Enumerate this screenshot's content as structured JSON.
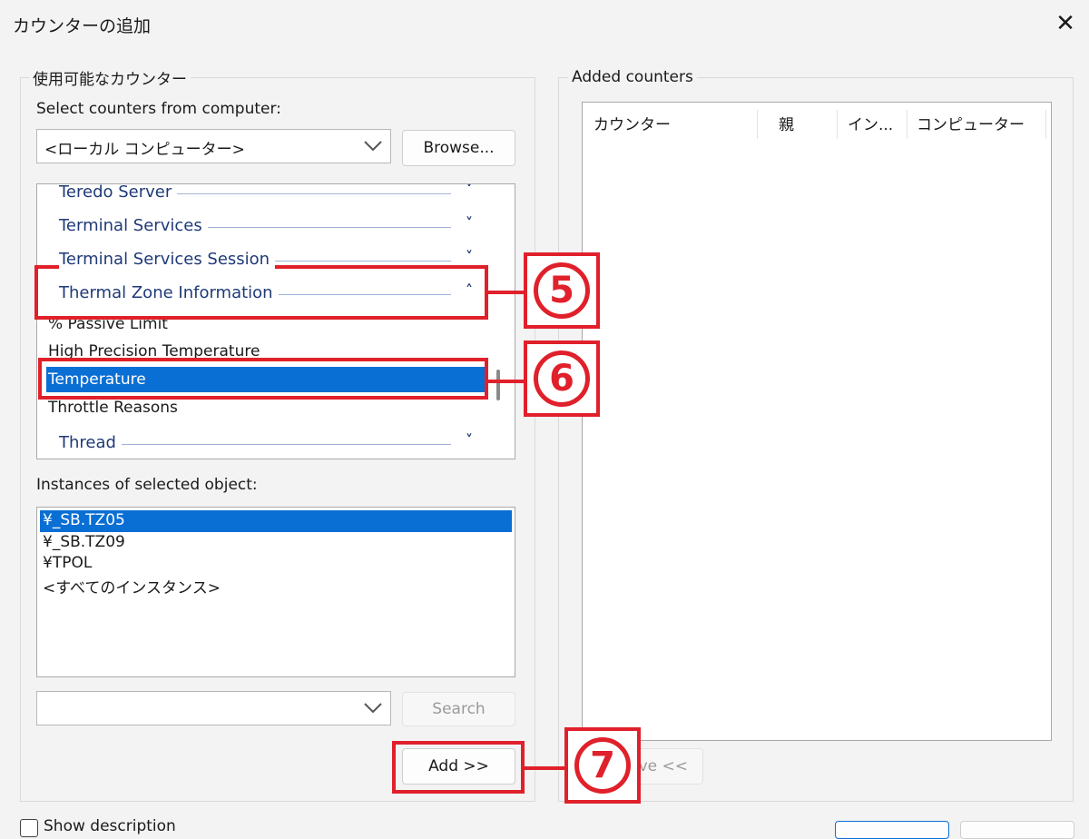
{
  "window": {
    "title": "カウンターの追加",
    "close_glyph": "✕"
  },
  "left": {
    "legend": "使用可能なカウンター",
    "select_from_label": "Select counters from computer:",
    "computer_value": "<ローカル コンピューター>",
    "browse_label": "Browse...",
    "categories": [
      {
        "name": "Teredo Server",
        "arrow": "˅"
      },
      {
        "name": "Terminal Services",
        "arrow": "˅"
      },
      {
        "name": "Terminal Services Session",
        "arrow": "˅"
      },
      {
        "name": "Thermal Zone Information",
        "arrow": "˄"
      },
      {
        "name": "Thread",
        "arrow": "˅"
      }
    ],
    "counters": [
      "% Passive Limit",
      "High Precision Temperature",
      "Temperature",
      "Throttle Reasons"
    ],
    "instances_label": "Instances of selected object:",
    "instances": [
      "¥_SB.TZ05",
      "¥_SB.TZ09",
      "¥TPOL",
      "<すべてのインスタンス>"
    ],
    "search_value": "",
    "search_label": "Search",
    "add_label": "Add >>"
  },
  "right": {
    "legend": "Added counters",
    "columns": [
      "カウンター",
      "親",
      "イン...",
      "コンピューター"
    ],
    "remove_label": "ve <<"
  },
  "footer": {
    "show_description_label": "Show description"
  },
  "annotations": {
    "step5": "5",
    "step6": "6",
    "step7": "7",
    "accent": "#e0202a"
  },
  "colors": {
    "selection": "#0a6fd4",
    "category_text": "#1f3a78"
  }
}
